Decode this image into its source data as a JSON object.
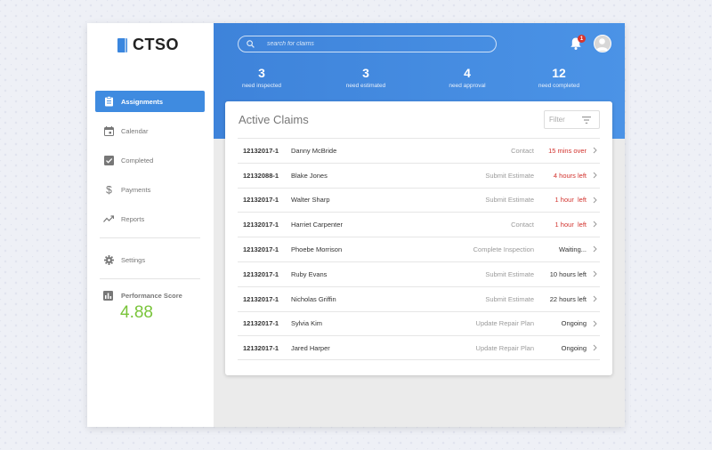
{
  "app": {
    "name": "CTSO"
  },
  "sidebar": {
    "items": [
      {
        "label": "Assignments",
        "icon": "clipboard-icon",
        "active": true
      },
      {
        "label": "Calendar",
        "icon": "calendar-icon",
        "active": false
      },
      {
        "label": "Completed",
        "icon": "checkbox-icon",
        "active": false
      },
      {
        "label": "Payments",
        "icon": "dollar-icon",
        "active": false
      },
      {
        "label": "Reports",
        "icon": "trend-icon",
        "active": false
      }
    ],
    "settings_label": "Settings",
    "performance": {
      "label": "Performance Score",
      "value": "4.88"
    }
  },
  "header": {
    "search_placeholder": "search for claims",
    "notification_count": "1",
    "stats": [
      {
        "value": "3",
        "label": "need inspected"
      },
      {
        "value": "3",
        "label": "need estimated"
      },
      {
        "value": "4",
        "label": "need approval"
      },
      {
        "value": "12",
        "label": "need completed"
      }
    ]
  },
  "claims": {
    "title": "Active Claims",
    "filter_placeholder": "Filter",
    "rows": [
      {
        "id": "12132017-1",
        "name": "Danny McBride",
        "task": "Contact",
        "status": "15 mins over",
        "urgent": true
      },
      {
        "id": "12132088-1",
        "name": "Blake Jones",
        "task": "Submit Estimate",
        "status": "4 hours left",
        "urgent": true
      },
      {
        "id": "12132017-1",
        "name": "Walter Sharp",
        "task": "Submit Estimate",
        "status": "1 hour  left",
        "urgent": true
      },
      {
        "id": "12132017-1",
        "name": "Harriet Carpenter",
        "task": "Contact",
        "status": "1 hour  left",
        "urgent": true
      },
      {
        "id": "12132017-1",
        "name": "Phoebe Morrison",
        "task": "Complete Inspection",
        "status": "Waiting...",
        "urgent": false
      },
      {
        "id": "12132017-1",
        "name": "Ruby Evans",
        "task": "Submit Estimate",
        "status": "10 hours left",
        "urgent": false
      },
      {
        "id": "12132017-1",
        "name": "Nicholas Griffin",
        "task": "Submit Estimate",
        "status": "22 hours left",
        "urgent": false
      },
      {
        "id": "12132017-1",
        "name": "Sylvia Kim",
        "task": "Update Repair Plan",
        "status": "Ongoing",
        "urgent": false
      },
      {
        "id": "12132017-1",
        "name": "Jared Harper",
        "task": "Update Repair Plan",
        "status": "Ongoing",
        "urgent": false
      }
    ]
  },
  "colors": {
    "accent": "#3f8be0",
    "urgent": "#d2322d",
    "score": "#79c43a"
  }
}
